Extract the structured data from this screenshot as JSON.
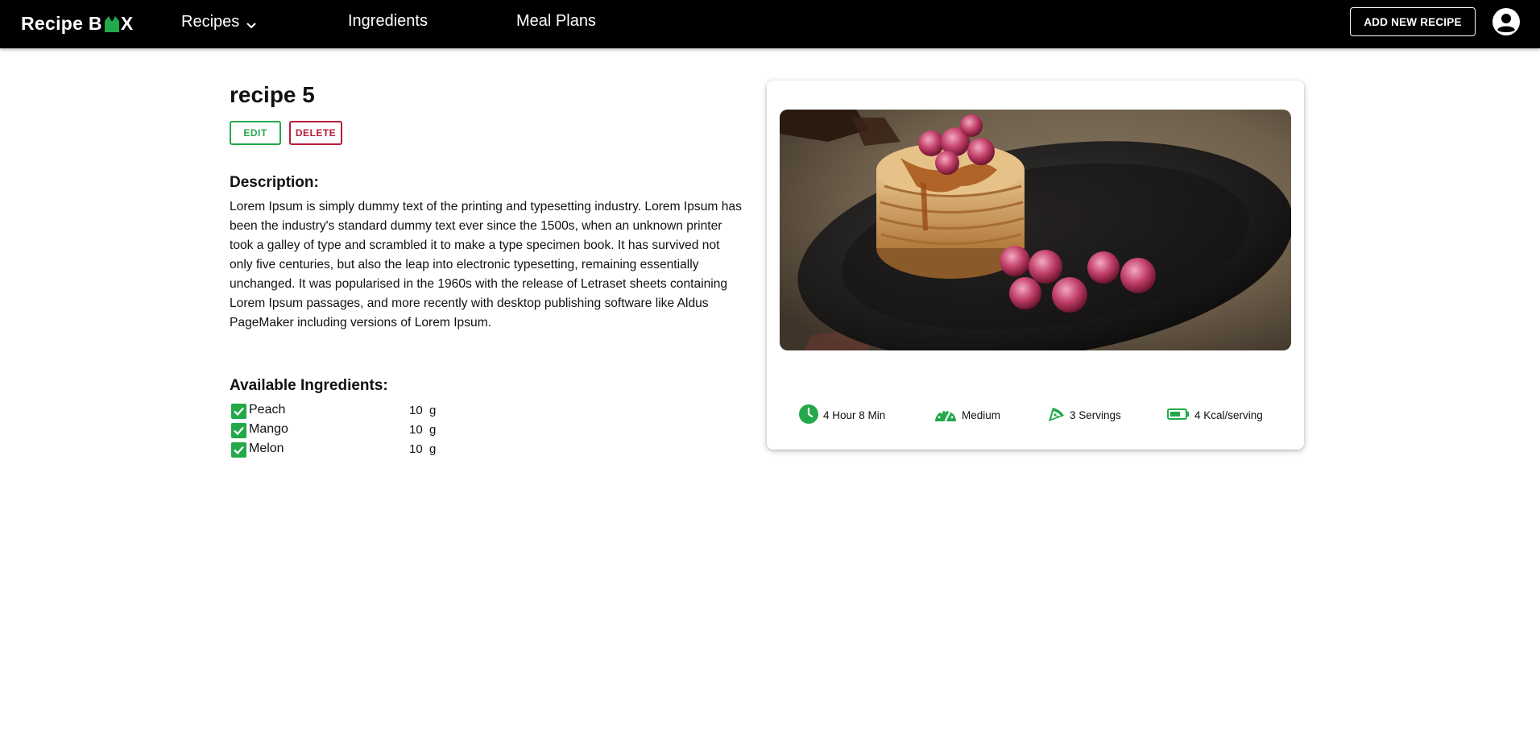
{
  "brand": {
    "part1": "Recipe B",
    "part2": "X"
  },
  "nav": {
    "recipes": "Recipes",
    "ingredients": "Ingredients",
    "meal_plans": "Meal Plans",
    "add_button": "ADD NEW RECIPE"
  },
  "recipe": {
    "title": "recipe 5",
    "edit_label": "EDIT",
    "delete_label": "DELETE",
    "description_heading": "Description:",
    "description": "Lorem Ipsum is simply dummy text of the printing and typesetting industry. Lorem Ipsum has been the industry's standard dummy text ever since the 1500s, when an unknown printer took a galley of type and scrambled it to make a type specimen book. It has survived not only five centuries, but also the leap into electronic typesetting, remaining essentially unchanged. It was popularised in the 1960s with the release of Letraset sheets containing Lorem Ipsum passages, and more recently with desktop publishing software like Aldus PageMaker including versions of Lorem Ipsum.",
    "ingredients_heading": "Available Ingredients:",
    "ingredients": [
      {
        "name": "Peach",
        "qty": "10  g"
      },
      {
        "name": "Mango",
        "qty": "10  g"
      },
      {
        "name": "Melon",
        "qty": "10  g"
      }
    ]
  },
  "stats": {
    "time": "4 Hour 8 Min",
    "difficulty": "Medium",
    "servings": "3 Servings",
    "calories": "4 Kcal/serving"
  },
  "icons": {
    "brand_box": "box-icon",
    "caret": "chevron-down-icon",
    "account": "account-circle-icon",
    "check": "checkbox-checked-icon",
    "time": "clock-icon",
    "difficulty": "speedometer-icon",
    "servings": "pizza-slice-icon",
    "calories": "battery-icon"
  },
  "colors": {
    "accent_green": "#23a94a",
    "delete_red": "#b71c3a",
    "nav_bg": "#000000"
  }
}
